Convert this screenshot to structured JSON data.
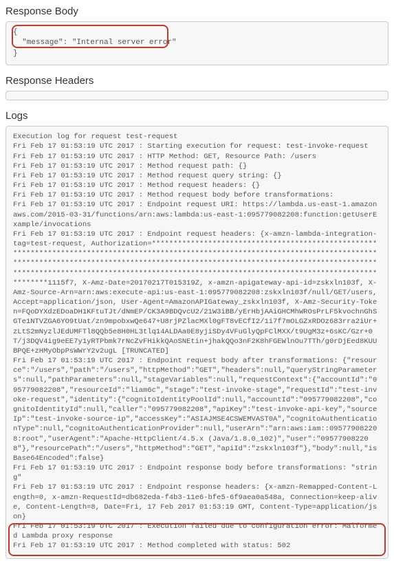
{
  "sections": {
    "response_body_title": "Response Body",
    "response_headers_title": "Response Headers",
    "logs_title": "Logs"
  },
  "response_body": "{\n  \"message\": \"Internal server error\"\n}",
  "response_headers": "",
  "logs": "Execution log for request test-request\nFri Feb 17 01:53:19 UTC 2017 : Starting execution for request: test-invoke-request\nFri Feb 17 01:53:19 UTC 2017 : HTTP Method: GET, Resource Path: /users\nFri Feb 17 01:53:19 UTC 2017 : Method request path: {}\nFri Feb 17 01:53:19 UTC 2017 : Method request query string: {}\nFri Feb 17 01:53:19 UTC 2017 : Method request headers: {}\nFri Feb 17 01:53:19 UTC 2017 : Method request body before transformations: \nFri Feb 17 01:53:19 UTC 2017 : Endpoint request URI: https://lambda.us-east-1.amazonaws.com/2015-03-31/functions/arn:aws:lambda:us-east-1:095779082208:function:getUserExample/invocations\nFri Feb 17 01:53:19 UTC 2017 : Endpoint request headers: {x-amzn-lambda-integration-tag=test-request, Authorization=************************************************************************************************************************************************************************************************************************************************************************************************************************1115f7, X-Amz-Date=20170217T015319Z, x-amzn-apigateway-api-id=zskxln103f, X-Amz-Source-Arn=arn:aws:execute-api:us-east-1:095779082208:zskxln103f/null/GET/users, Accept=application/json, User-Agent=AmazonAPIGateway_zskxln103f, X-Amz-Security-Token=FQoDYXdzEDoaDH1KFtuTJt/dNmEP/CK3A9BDQvcU2/21W3iBB/yErHbjAAiGHCMhWROsPrLF5kvochnGhSGTe1NTVZGA6YO9tUat/zn9mpobxwQe647+U8rjPZlacMXl0gFT8vECfI2/1i7f7mOLGZxRDOz683rra2iUr+zLtS2mNyzlJEdUMFTl8QQb5e8H0HL3tlq14ALDAa0E8yjiSDy4VFuGlyQpFClMXX/t9UgM3z+6sKC/Gzr+0T/j3DQV4ig9eEE7y1yRTPbmk7rNcZvFHikkQAoSNEtin+jhakQQo3nF2K8hFGEWlnOu7TTh/g0rDjEed8KUUBPQE+zHMyObpPsWWrY2v2ugL [TRUNCATED]\nFri Feb 17 01:53:19 UTC 2017 : Endpoint request body after transformations: {\"resource\":\"/users\",\"path\":\"/users\",\"httpMethod\":\"GET\",\"headers\":null,\"queryStringParameters\":null,\"pathParameters\":null,\"stageVariables\":null,\"requestContext\":{\"accountId\":\"095779082208\",\"resourceId\":\"liam6c\",\"stage\":\"test-invoke-stage\",\"requestId\":\"test-invoke-request\",\"identity\":{\"cognitoIdentityPoolId\":null,\"accountId\":\"095779082208\",\"cognitoIdentityId\":null,\"caller\":\"095779082208\",\"apiKey\":\"test-invoke-api-key\",\"sourceIp\":\"test-invoke-source-ip\",\"accessKey\":\"ASIAJMSE4CSWEMVAST0A\",\"cognitoAuthenticationType\":null,\"cognitoAuthenticationProvider\":null,\"userArn\":\"arn:aws:iam::095779082208:root\",\"userAgent\":\"Apache-HttpClient/4.5.x (Java/1.8.0_102)\",\"user\":\"095779082208\"},\"resourcePath\":\"/users\",\"httpMethod\":\"GET\",\"apiId\":\"zskxln103f\"},\"body\":null,\"isBase64Encoded\":false}\nFri Feb 17 01:53:19 UTC 2017 : Endpoint response body before transformations: \"string\"\nFri Feb 17 01:53:19 UTC 2017 : Endpoint response headers: {x-amzn-Remapped-Content-Length=0, x-amzn-RequestId=db682eda-f4b3-11e6-bfe5-6f9aea0a548a, Connection=keep-alive, Content-Length=8, Date=Fri, 17 Feb 2017 01:53:19 GMT, Content-Type=application/json}\nFri Feb 17 01:53:19 UTC 2017 : Execution failed due to configuration error: Malformed Lambda proxy response\nFri Feb 17 01:53:19 UTC 2017 : Method completed with status: 502"
}
